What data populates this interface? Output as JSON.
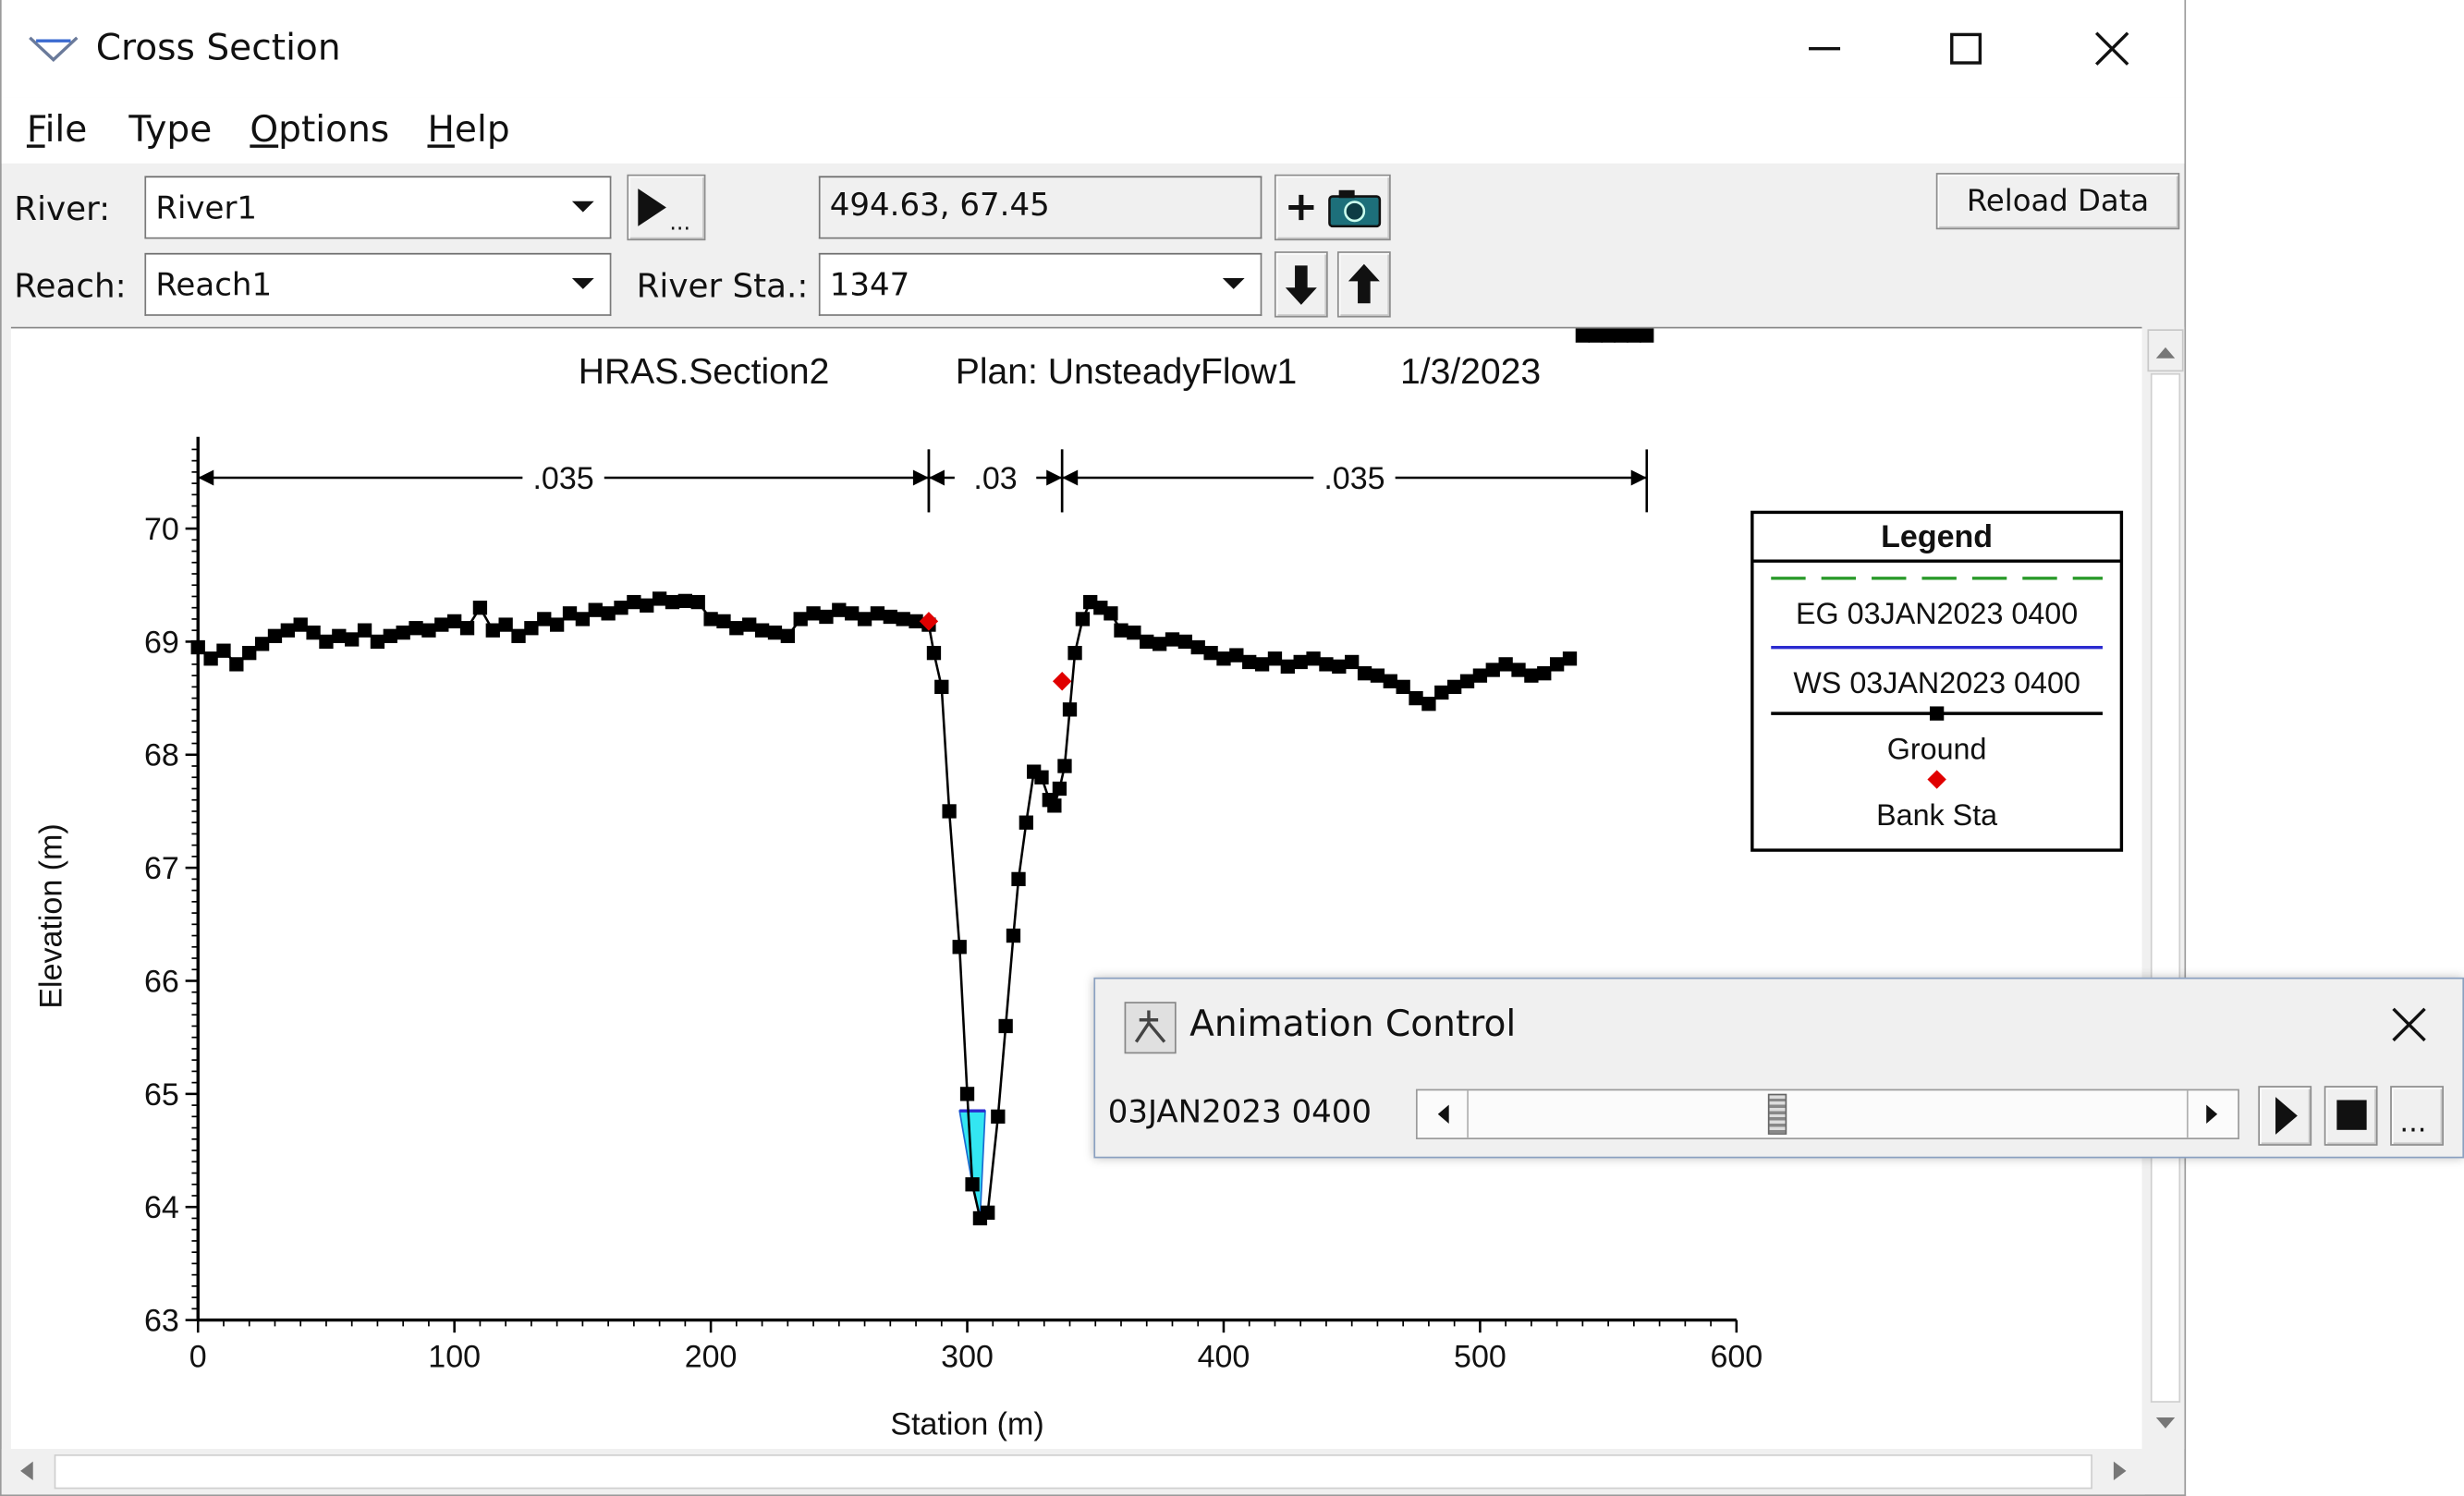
{
  "window": {
    "title": "Cross Section",
    "controls": {
      "minimize": "minimize-icon",
      "maximize": "maximize-icon",
      "close": "close-icon"
    }
  },
  "menu": [
    {
      "label": "File",
      "mnemonic": "F",
      "rest": "ile"
    },
    {
      "label": "Type",
      "mnemonic": "",
      "rest": "Type"
    },
    {
      "label": "Options",
      "mnemonic": "O",
      "rest": "ptions"
    },
    {
      "label": "Help",
      "mnemonic": "H",
      "rest": "elp"
    }
  ],
  "toolbar": {
    "river_label": "River:",
    "river_value": "River1",
    "reach_label": "Reach:",
    "reach_value": "Reach1",
    "station_label": "River Sta.:",
    "station_value": "1347",
    "coords": "494.63, 67.45",
    "reload_label": "Reload Data",
    "play_more": "..."
  },
  "chart_data": {
    "type": "line",
    "title_parts": [
      "HRAS.Section2",
      "Plan: UnsteadyFlow1",
      "1/3/2023"
    ],
    "xlabel": "Station (m)",
    "ylabel": "Elevation (m)",
    "xlim": [
      0,
      600
    ],
    "ylim": [
      63,
      70.7
    ],
    "xticks": [
      0,
      100,
      200,
      300,
      400,
      500,
      600
    ],
    "yticks": [
      63,
      64,
      65,
      66,
      67,
      68,
      69,
      70
    ],
    "mannings": [
      {
        "n": ".035",
        "from": 0,
        "to": 285
      },
      {
        "n": ".03",
        "from": 285,
        "to": 337
      },
      {
        "n": ".035",
        "from": 337,
        "to": 565
      }
    ],
    "ground": {
      "x": [
        0,
        5,
        10,
        15,
        20,
        25,
        30,
        35,
        40,
        45,
        50,
        55,
        60,
        65,
        70,
        75,
        80,
        85,
        90,
        95,
        100,
        105,
        110,
        115,
        120,
        125,
        130,
        135,
        140,
        145,
        150,
        155,
        160,
        165,
        170,
        175,
        180,
        185,
        190,
        195,
        200,
        205,
        210,
        215,
        220,
        225,
        230,
        235,
        240,
        245,
        250,
        255,
        260,
        265,
        270,
        275,
        280,
        285,
        287,
        290,
        293,
        297,
        300,
        302,
        305,
        308,
        312,
        315,
        318,
        320,
        323,
        326,
        329,
        332,
        334,
        336,
        338,
        340,
        342,
        345,
        348,
        352,
        356,
        360,
        365,
        370,
        375,
        380,
        385,
        390,
        395,
        400,
        405,
        410,
        415,
        420,
        425,
        430,
        435,
        440,
        445,
        450,
        455,
        460,
        465,
        470,
        475,
        480,
        485,
        490,
        495,
        500,
        505,
        510,
        515,
        520,
        525,
        530,
        535,
        540,
        545,
        550,
        555,
        560,
        565
      ],
      "y": [
        68.95,
        68.85,
        68.92,
        68.8,
        68.9,
        68.98,
        69.05,
        69.1,
        69.15,
        69.08,
        69.0,
        69.05,
        69.02,
        69.1,
        69.0,
        69.05,
        69.08,
        69.12,
        69.1,
        69.15,
        69.18,
        69.12,
        69.3,
        69.1,
        69.15,
        69.05,
        69.12,
        69.2,
        69.15,
        69.25,
        69.2,
        69.28,
        69.25,
        69.3,
        69.35,
        69.32,
        69.38,
        69.35,
        69.36,
        69.35,
        69.2,
        69.18,
        69.12,
        69.15,
        69.1,
        69.08,
        69.05,
        69.2,
        69.25,
        69.22,
        69.28,
        69.25,
        69.2,
        69.25,
        69.22,
        69.2,
        69.18,
        69.15,
        68.9,
        68.6,
        67.5,
        66.3,
        65.0,
        64.2,
        63.9,
        63.95,
        64.8,
        65.6,
        66.4,
        66.9,
        67.4,
        67.85,
        67.8,
        67.6,
        67.55,
        67.7,
        67.9,
        68.4,
        68.9,
        69.2,
        69.35,
        69.3,
        69.25,
        69.1,
        69.08,
        69.0,
        68.98,
        69.02,
        69.0,
        68.95,
        68.9,
        68.85,
        68.88,
        68.82,
        68.8,
        68.85,
        68.78,
        68.82,
        68.85,
        68.8,
        68.78,
        68.82,
        68.72,
        68.7,
        68.65,
        68.6,
        68.5,
        68.45,
        68.55,
        68.6,
        68.65,
        68.7,
        68.75,
        68.8,
        68.75,
        68.7,
        68.72,
        68.8,
        68.85
      ]
    },
    "bank_stations": [
      {
        "x": 285,
        "y": 69.18
      },
      {
        "x": 337,
        "y": 68.65
      }
    ],
    "water_surface": {
      "elevation": 64.85,
      "x_left": 297,
      "x_right": 307
    },
    "legend": {
      "title": "Legend",
      "placement": "right",
      "items": [
        {
          "label": "EG 03JAN2023 0400",
          "color": "#2a9a2a",
          "style": "dashed"
        },
        {
          "label": "WS 03JAN2023 0400",
          "color": "#2b2bd0",
          "style": "solid"
        },
        {
          "label": "Ground",
          "color": "#000000",
          "style": "solid-square-marker"
        },
        {
          "label": "Bank Sta",
          "color": "#e00000",
          "style": "diamond-marker"
        }
      ]
    },
    "colors": {
      "ground": "#000000",
      "bank": "#e00000",
      "water": "#33e6f2"
    }
  },
  "animation": {
    "title": "Animation Control",
    "time": "03JAN2023 0400",
    "slider_position": 0.43,
    "more": "..."
  }
}
